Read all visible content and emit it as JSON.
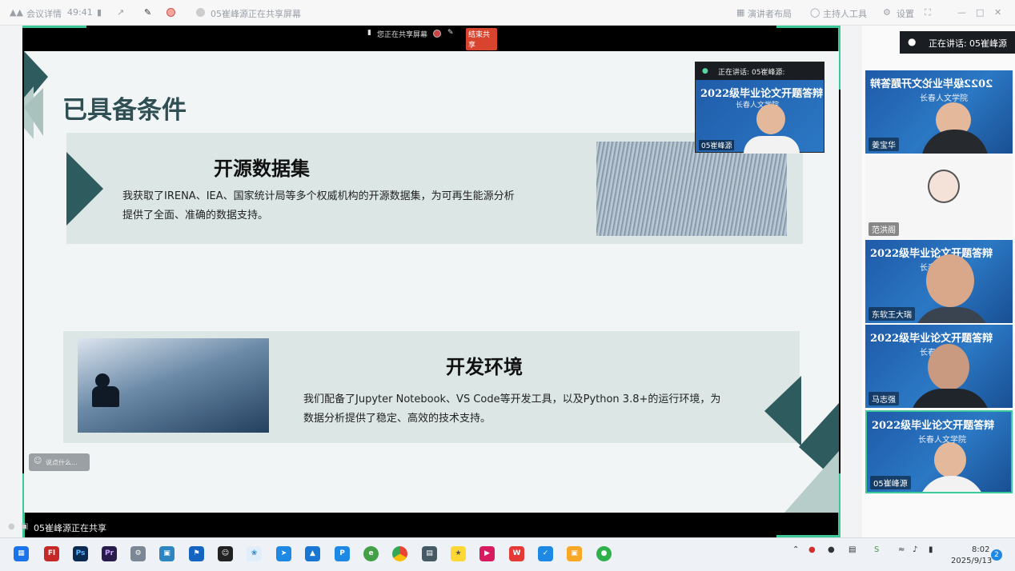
{
  "topbar": {
    "meeting_detail": "会议详情",
    "timer": "49:41",
    "sharing_notice": "05崔峰源正在共享屏幕",
    "presenter_layout": "演讲者布局",
    "host_tools": "主持人工具",
    "settings": "设置"
  },
  "sharebar": {
    "sharing_label": "您正在共享屏幕",
    "end_share": "结束共享"
  },
  "slide": {
    "title": "已具备条件",
    "card1": {
      "title": "开源数据集",
      "text_line1": "我获取了IRENA、IEA、国家统计局等多个权威机构的开源数据集，为可再生能源分析",
      "text_line2": "提供了全面、准确的数据支持。"
    },
    "card2": {
      "title": "开发环境",
      "text_line1": "我们配备了Jupyter Notebook、VS Code等开发工具，以及Python 3.8+的运行环境，为",
      "text_line2": "数据分析提供了稳定、高效的技术支持。"
    }
  },
  "chat_hint": "说点什么...",
  "sharing_status": "05崔峰源正在共享",
  "speaking": {
    "label": "正在讲话:",
    "name": "05崔峰源"
  },
  "overlay_video": {
    "speaking_label": "正在讲话:",
    "speaking_name": "05崔峰源:",
    "banner": "2022级毕业论文开题答辩",
    "sub": "长春人文学院",
    "name": "05崔峰源"
  },
  "participants": [
    {
      "name": "姜宝华",
      "banner": "2022级毕业论文开题答辩",
      "sub": "长春人文学院"
    },
    {
      "name": "范洪阁",
      "banner": "",
      "sub": ""
    },
    {
      "name": "东软王大瑞",
      "banner": "2022级毕业论文开题答辩",
      "sub": "长春人"
    },
    {
      "name": "马志强",
      "banner": "2022级毕业论文开题答辩",
      "sub": "长春人"
    },
    {
      "name": "05崔峰源",
      "banner": "2022级毕业论文开题答辩",
      "sub": "长春人文学院"
    }
  ],
  "taskbar": {
    "ps": "Ps",
    "pr": "Pr",
    "fl": "Fl",
    "time": "8:02",
    "date": "2025/9/13",
    "notifications": "2"
  }
}
